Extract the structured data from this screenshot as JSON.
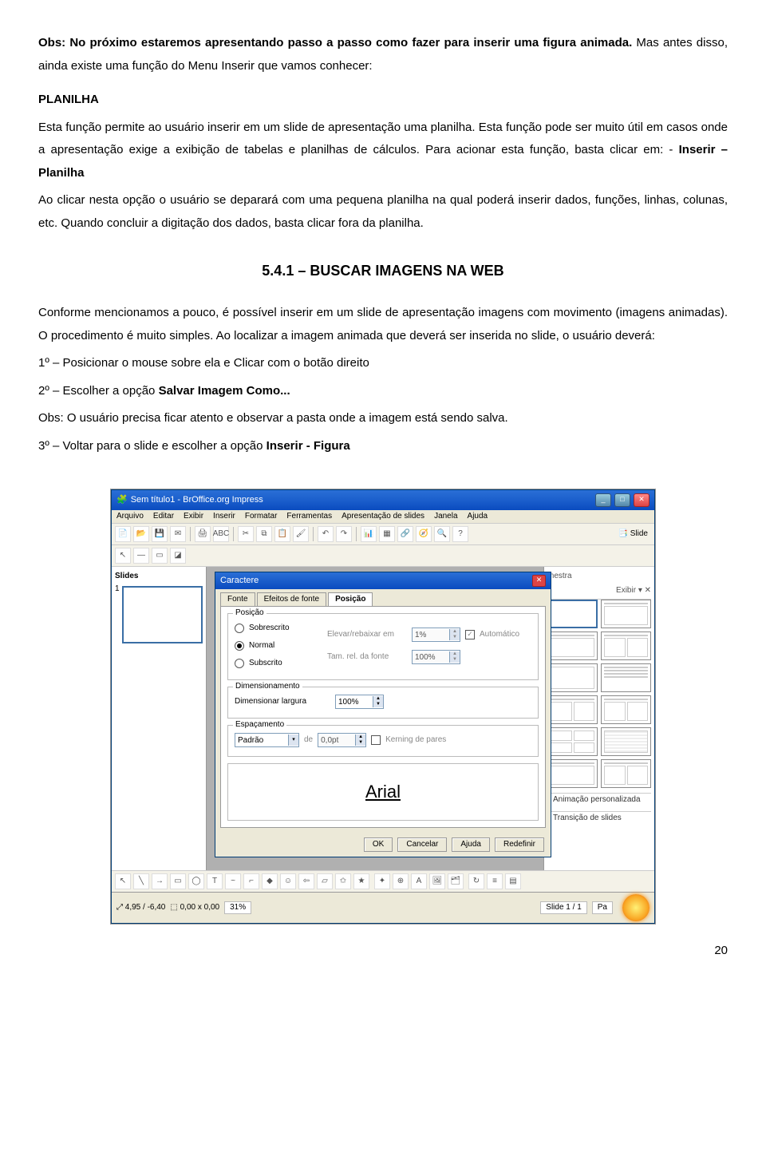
{
  "para1": "Obs: No próximo estaremos apresentando passo a passo como fazer para inserir uma figura animada.",
  "para1b": " Mas antes disso, ainda existe uma função do Menu Inserir que vamos conhecer:",
  "heading_planilha": "PLANILHA",
  "para2a": "Esta função permite ao usuário inserir em um slide de apresentação uma planilha. Esta função pode ser muito útil em casos onde a apresentação exige a exibição de tabelas e planilhas de cálculos. Para acionar esta função, basta clicar em: - ",
  "para2b": "Inserir – Planilha",
  "para3": "Ao clicar nesta opção o usuário se deparará com uma pequena planilha na qual poderá inserir dados, funções, linhas, colunas, etc. Quando concluir a digitação dos dados, basta clicar fora da planilha.",
  "section_title": "5.4.1 – BUSCAR IMAGENS NA WEB",
  "para4": "Conforme mencionamos a pouco, é possível inserir em um slide de apresentação imagens com movimento (imagens animadas). O procedimento é muito simples. Ao localizar a imagem animada que deverá ser inserida no slide, o usuário deverá:",
  "step1": "1º – Posicionar o mouse sobre ela e Clicar com o botão direito",
  "step2a": "2º – Escolher a opção ",
  "step2b": "Salvar Imagem Como...",
  "obs": "Obs: O usuário precisa ficar atento e observar a pasta onde a imagem está sendo salva.",
  "step3a": "3º – Voltar para o slide e escolher a opção ",
  "step3b": "Inserir - Figura",
  "page_number": "20",
  "app": {
    "title": "Sem título1 - BrOffice.org Impress",
    "menus": [
      "Arquivo",
      "Editar",
      "Exibir",
      "Inserir",
      "Formatar",
      "Ferramentas",
      "Apresentação de slides",
      "Janela",
      "Ajuda"
    ],
    "toolbar_slide": "Slide",
    "slides_label": "Slides",
    "right_head": "mestra",
    "right_close": "Exibir ▾  ✕",
    "accordion1": "Animação personalizada",
    "accordion2": "Transição de slides",
    "dialog": {
      "title": "Caractere",
      "tabs": [
        "Fonte",
        "Efeitos de fonte",
        "Posição"
      ],
      "group_pos": "Posição",
      "opt_sobre": "Sobrescrito",
      "opt_normal": "Normal",
      "opt_sub": "Subscrito",
      "lbl_elevar": "Elevar/rebaixar em",
      "val_elevar": "1%",
      "lbl_auto": "Automático",
      "lbl_tam": "Tam. rel. da fonte",
      "val_tam": "100%",
      "group_dim": "Dimensionamento",
      "lbl_larg": "Dimensionar largura",
      "val_larg": "100%",
      "group_esp": "Espaçamento",
      "combo_padrao": "Padrão",
      "lbl_de": "de",
      "val_de": "0,0pt",
      "lbl_kern": "Kerning de pares",
      "preview": "Arial",
      "btns": [
        "OK",
        "Cancelar",
        "Ajuda",
        "Redefinir"
      ]
    },
    "status": {
      "coord1": "4,95 / -6,40",
      "coord2": "0,00 x 0,00",
      "zoom": "31%",
      "slide": "Slide 1 / 1",
      "layout": "Pa"
    }
  }
}
